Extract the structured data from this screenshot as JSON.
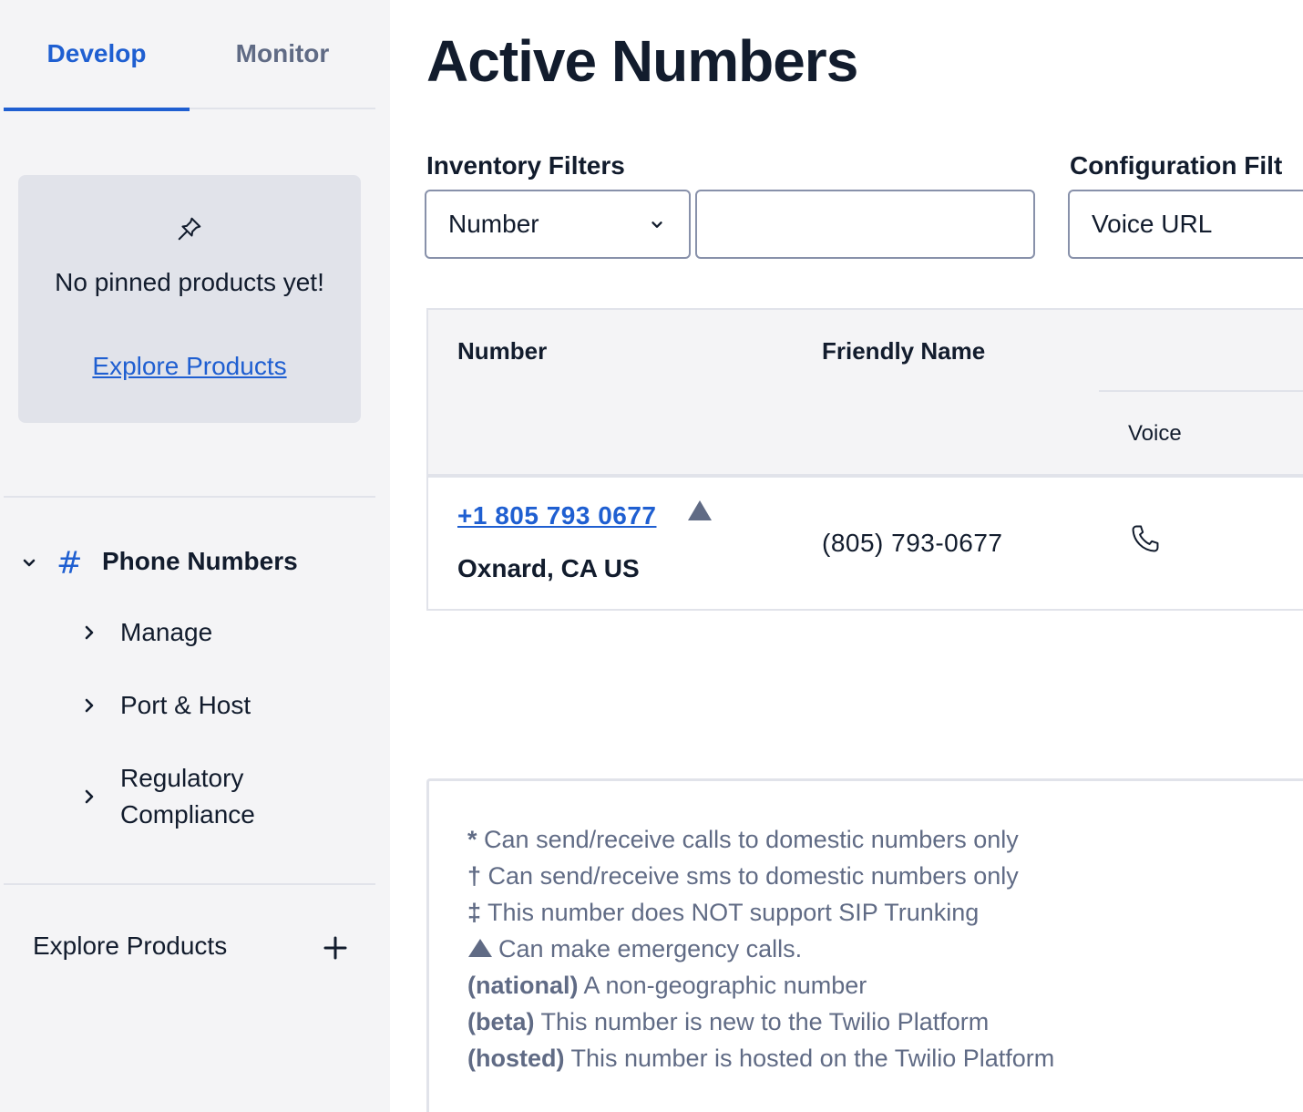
{
  "sidebar": {
    "tabs": [
      {
        "label": "Develop",
        "active": true
      },
      {
        "label": "Monitor",
        "active": false
      }
    ],
    "pinned": {
      "message": "No pinned products yet!",
      "link": "Explore Products",
      "icon": "pin-icon"
    },
    "nav": {
      "group_label": "Phone Numbers",
      "group_icon": "hash-icon",
      "items": [
        {
          "label": "Manage"
        },
        {
          "label": "Port & Host"
        },
        {
          "label": "Regulatory Compliance"
        }
      ]
    },
    "explore": {
      "label": "Explore Products",
      "icon": "plus-icon"
    }
  },
  "main": {
    "title": "Active Numbers",
    "inventory_filters": {
      "label": "Inventory Filters",
      "select_value": "Number",
      "input_value": ""
    },
    "configuration_filters": {
      "label": "Configuration Filt",
      "select_value": "Voice URL"
    },
    "table": {
      "headers": {
        "number": "Number",
        "friendly_name": "Friendly Name",
        "voice": "Voice"
      },
      "rows": [
        {
          "number": "+1 805 793 0677",
          "location": "Oxnard, CA US",
          "friendly_name": "(805) 793-0677",
          "emergency": true,
          "voice_icon": "phone-icon"
        }
      ]
    },
    "legend": [
      {
        "marker": "*",
        "text": "Can send/receive calls to domestic numbers only"
      },
      {
        "marker": "†",
        "text": "Can send/receive sms to domestic numbers only"
      },
      {
        "marker": "‡",
        "text": "This number does NOT support SIP Trunking"
      },
      {
        "marker": "",
        "text": "Can make emergency calls."
      },
      {
        "marker": "(national)",
        "text": "A non-geographic number"
      },
      {
        "marker": "(beta)",
        "text": "This number is new to the Twilio Platform"
      },
      {
        "marker": "(hosted)",
        "text": "This number is hosted on the Twilio Platform"
      }
    ]
  },
  "colors": {
    "accent": "#1f5fd1",
    "sidebar_bg": "#f4f4f6",
    "text": "#121c2d",
    "muted": "#606b85",
    "border": "#e1e3ea"
  }
}
